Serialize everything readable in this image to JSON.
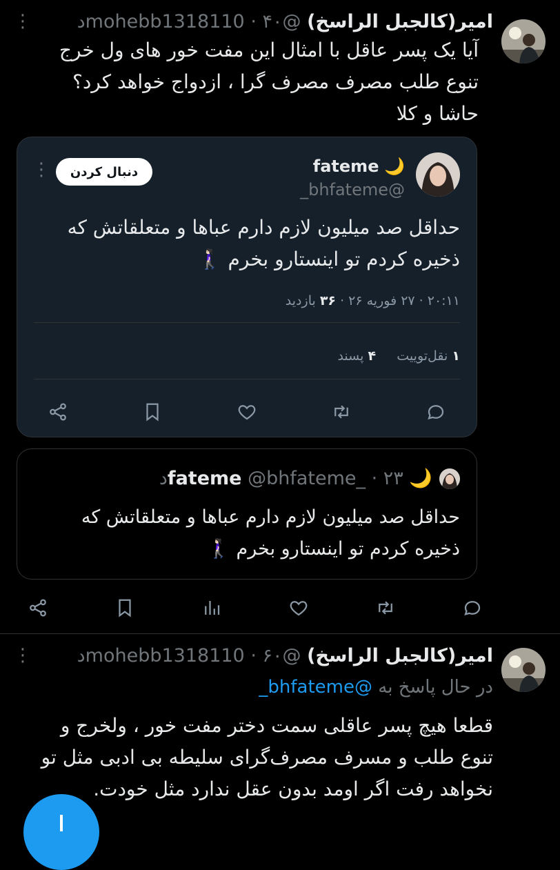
{
  "tweet1": {
    "name": "امیر(کالجبل الراسخ)",
    "handle": "@mohebb1318110",
    "time": "۴۰د",
    "text": "آیا یک پسر عاقل با امثال این مفت خور های ول خرج تنوع طلب مصرف مصرف گرا ، ازدواج خواهد کرد؟ حاشا و کلا"
  },
  "embedded": {
    "name": "fateme",
    "emoji": "🌙",
    "handle": "@bhfateme_",
    "follow_label": "دنبال کردن",
    "text": "حداقل صد میلیون لازم دارم عباها و متعلقاتش که ذخیره کردم تو اینستارو  بخرم 🚶🏻‍♀️",
    "time": "۲۰:۱۱",
    "date": "۲۷ فوریه ۲۶",
    "views_num": "۳۶",
    "views_label": "بازدید",
    "retweets_num": "۱",
    "retweets_label": "نقل‌توییت",
    "likes_num": "۴",
    "likes_label": "پسند"
  },
  "reply_card": {
    "name": "fateme",
    "emoji": "🌙",
    "handle": "@bhfateme_",
    "time": "۲۳د",
    "text": "حداقل صد میلیون لازم دارم عباها و متعلقاتش که ذخیره کردم تو اینستارو  بخرم 🚶🏻‍♀️"
  },
  "tweet2": {
    "name": "امیر(کالجبل الراسخ)",
    "handle": "@mohebb1318110",
    "time": "۶۰د",
    "replying_label": "در حال پاسخ به",
    "replying_to": "@bhfateme_",
    "text": "قطعا هیچ پسر عاقلی سمت دختر مفت خور ، ولخرج و تنوع طلب و مسرف مصرف‌گرای سلیطه بی ادبی مثل تو نخواهد رفت اگر اومد بدون عقل ندارد مثل خودت."
  },
  "icons": {
    "share": "share-icon",
    "bookmark": "bookmark-icon",
    "like": "heart-icon",
    "retweet": "retweet-icon",
    "reply": "reply-icon",
    "views": "views-icon"
  },
  "colors": {
    "background": "#000000",
    "quote_background": "#15202b",
    "accent": "#1d9bf0",
    "muted": "#71767b"
  }
}
